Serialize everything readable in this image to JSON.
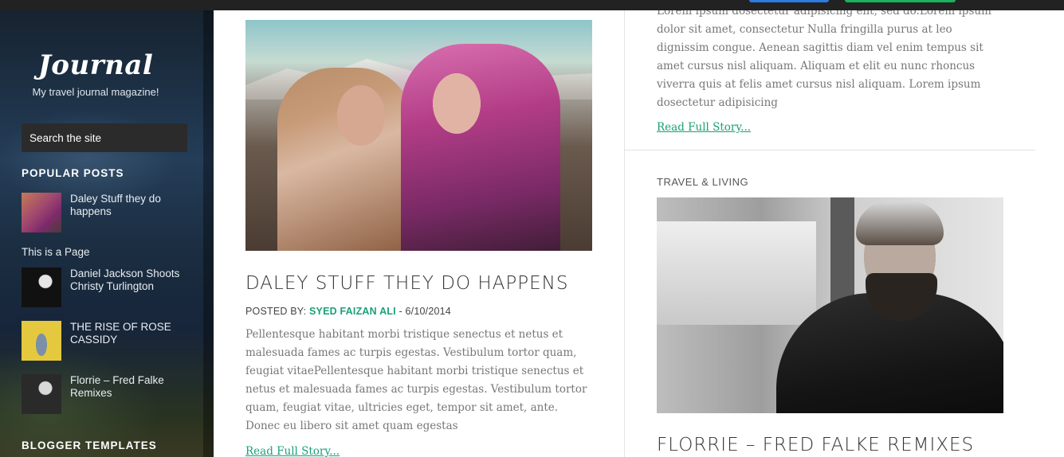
{
  "sidebar": {
    "title": "Journal",
    "tagline": "My travel journal magazine!",
    "search_placeholder": "Search the site",
    "popular_heading": "POPULAR POSTS",
    "popular_posts": [
      {
        "label": "Daley Stuff they do happens",
        "thumb": "women-photo-thumbnail"
      },
      {
        "label": "Daniel Jackson Shoots Christy Turlington",
        "thumb": "portrait-bw-thumbnail"
      },
      {
        "label": "THE RISE OF ROSE CASSIDY",
        "thumb": "yellow-wall-thumbnail"
      },
      {
        "label": "Florrie – Fred Falke Remixes",
        "thumb": "bearded-man-thumbnail"
      }
    ],
    "page_link": "This is a Page",
    "blogger_heading": "BLOGGER TEMPLATES"
  },
  "left_post": {
    "title": "DALEY STUFF THEY DO HAPPENS",
    "meta_prefix": "POSTED BY: ",
    "author": "SYED FAIZAN ALI",
    "meta_date": " - 6/10/2014",
    "excerpt": "Pellentesque habitant morbi tristique senectus et netus et malesuada fames ac turpis egestas. Vestibulum tortor quam, feugiat vitaePellentesque habitant morbi tristique senectus et netus et malesuada fames ac turpis egestas. Vestibulum tortor quam, feugiat vitae, ultricies eget, tempor sit amet, ante. Donec eu libero sit amet quam egestas",
    "read_more": "Read Full Story..."
  },
  "right_top": {
    "excerpt": "Lorem ipsum dosectetur adipisicing elit, sed do.Lorem ipsum dolor sit amet, consectetur Nulla fringilla purus at leo dignissim congue. Aenean sagittis diam vel enim tempus sit amet cursus nisl aliquam. Aliquam et elit eu nunc rhoncus viverra quis at felis amet cursus nisl aliquam. Lorem ipsum dosectetur adipisicing",
    "read_more": "Read Full Story..."
  },
  "right_post": {
    "category": "TRAVEL & LIVING",
    "title": "FLORRIE – FRED FALKE REMIXES"
  },
  "colors": {
    "accent_green": "#1aa078",
    "topbar": "#222222",
    "topbar_blue": "#2c7be5",
    "topbar_green": "#18b35a"
  }
}
